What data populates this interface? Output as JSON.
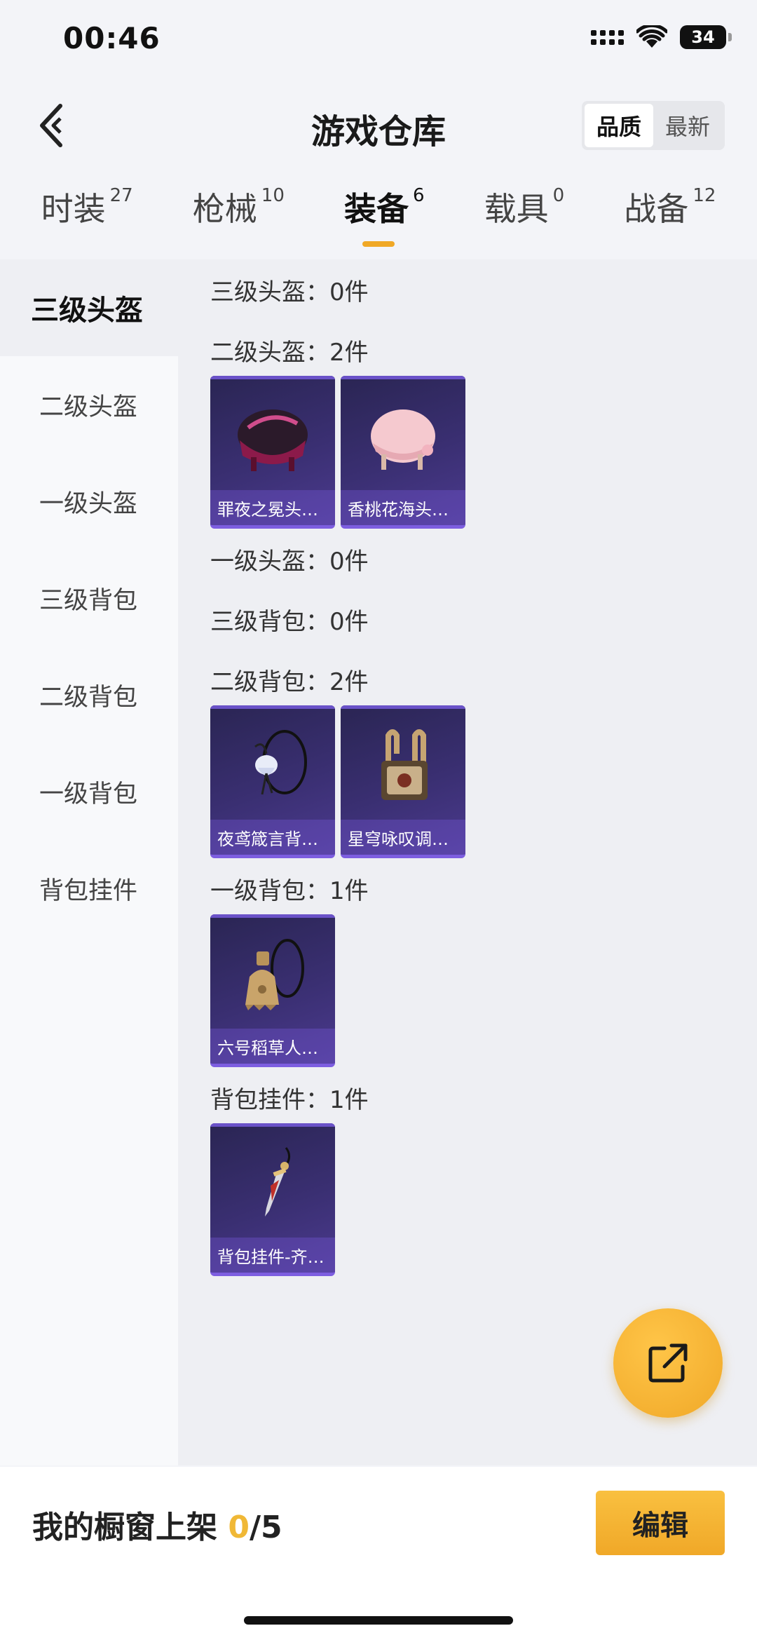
{
  "status_bar": {
    "time": "00:46",
    "battery": "34"
  },
  "nav": {
    "title": "游戏仓库",
    "sort_options": [
      {
        "label": "品质",
        "active": true
      },
      {
        "label": "最新",
        "active": false
      }
    ]
  },
  "tabs": [
    {
      "label": "时装",
      "count": "27"
    },
    {
      "label": "枪械",
      "count": "10"
    },
    {
      "label": "装备",
      "count": "6",
      "active": true
    },
    {
      "label": "载具",
      "count": "0"
    },
    {
      "label": "战备",
      "count": "12"
    }
  ],
  "sidebar": {
    "items": [
      {
        "label": "三级头盔",
        "active": true
      },
      {
        "label": "二级头盔"
      },
      {
        "label": "一级头盔"
      },
      {
        "label": "三级背包"
      },
      {
        "label": "二级背包"
      },
      {
        "label": "一级背包"
      },
      {
        "label": "背包挂件"
      }
    ]
  },
  "sections": [
    {
      "title": "三级头盔：0件",
      "items": []
    },
    {
      "title": "二级头盔：2件",
      "items": [
        {
          "name": "罪夜之冕头…",
          "icon": "helmet-dark-icon"
        },
        {
          "name": "香桃花海头…",
          "icon": "helmet-pink-icon"
        }
      ]
    },
    {
      "title": "一级头盔：0件",
      "items": []
    },
    {
      "title": "三级背包：0件",
      "items": []
    },
    {
      "title": "二级背包：2件",
      "items": [
        {
          "name": "夜鸢箴言背…",
          "icon": "backpack-flower-icon"
        },
        {
          "name": "星穹咏叹调…",
          "icon": "backpack-gold-icon"
        }
      ]
    },
    {
      "title": "一级背包：1件",
      "items": [
        {
          "name": "六号稻草人…",
          "icon": "backpack-straw-icon"
        }
      ]
    },
    {
      "title": "背包挂件：1件",
      "items": [
        {
          "name": "背包挂件-齐…",
          "icon": "pendant-sword-icon"
        }
      ]
    }
  ],
  "bottom_bar": {
    "showcase_label": "我的橱窗上架",
    "showcase_current": "0",
    "showcase_total": "/5",
    "edit_label": "编辑"
  },
  "colors": {
    "accent": "#f0a826",
    "card_bg": "#3a2f72",
    "card_border": "#7d5ee0"
  }
}
